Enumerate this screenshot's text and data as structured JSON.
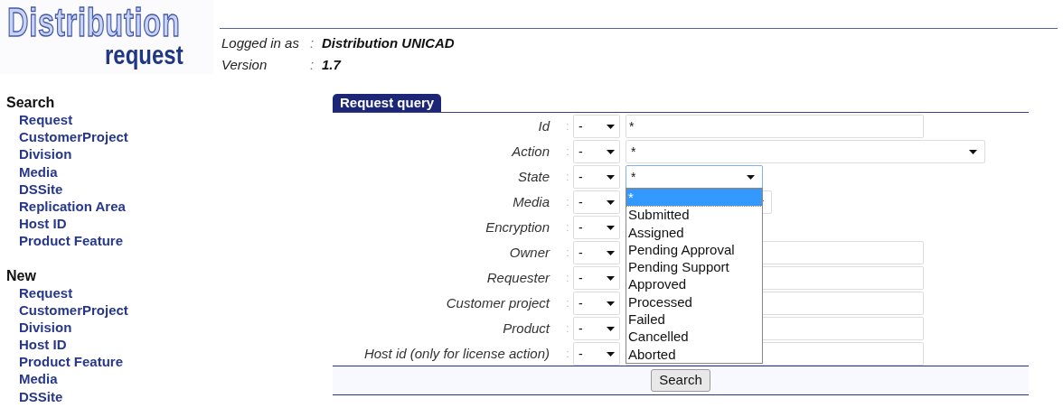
{
  "logo": {
    "title": "Distribution",
    "subtitle": "request"
  },
  "header": {
    "rows": [
      {
        "label": "Logged in as",
        "separator": ":",
        "value": "Distribution UNICAD"
      },
      {
        "label": "Version",
        "separator": ":",
        "value": "1.7"
      }
    ]
  },
  "sidebar": {
    "sections": [
      {
        "heading": "Search",
        "items": [
          "Request",
          "CustomerProject",
          "Division",
          "Media",
          "DSSite",
          "Replication Area",
          "Host ID",
          "Product Feature"
        ]
      },
      {
        "heading": "New",
        "items": [
          "Request",
          "CustomerProject",
          "Division",
          "Host ID",
          "Product Feature",
          "Media",
          "DSSite"
        ]
      }
    ]
  },
  "query": {
    "tab": "Request query",
    "fields": [
      {
        "label": "Id",
        "separator": ":",
        "operator": "-",
        "kind": "text",
        "value": "*"
      },
      {
        "label": "Action",
        "separator": ":",
        "operator": "-",
        "kind": "select",
        "value": "*"
      },
      {
        "label": "State",
        "separator": ":",
        "operator": "-",
        "kind": "select",
        "value": "*",
        "expanded": true
      },
      {
        "label": "Media",
        "separator": ":",
        "operator": "-",
        "kind": "select"
      },
      {
        "label": "Encryption",
        "separator": ":",
        "operator": "-",
        "kind": "hidden"
      },
      {
        "label": "Owner",
        "separator": ":",
        "operator": "-",
        "kind": "text"
      },
      {
        "label": "Requester",
        "separator": ":",
        "operator": "-",
        "kind": "text"
      },
      {
        "label": "Customer project",
        "separator": ":",
        "operator": "-",
        "kind": "text"
      },
      {
        "label": "Product",
        "separator": ":",
        "operator": "-",
        "kind": "text"
      },
      {
        "label": "Host id (only for license action)",
        "separator": ":",
        "operator": "-",
        "kind": "text"
      }
    ],
    "options": [
      {
        "label": "*",
        "selected": true
      },
      {
        "label": "Submitted",
        "selected": false
      },
      {
        "label": "Assigned",
        "selected": false
      },
      {
        "label": "Pending Approval",
        "selected": false
      },
      {
        "label": "Pending Support",
        "selected": false
      },
      {
        "label": "Approved",
        "selected": false
      },
      {
        "label": "Processed",
        "selected": false
      },
      {
        "label": "Failed",
        "selected": false
      },
      {
        "label": "Cancelled",
        "selected": false
      },
      {
        "label": "Aborted",
        "selected": false
      }
    ],
    "button": "Search"
  }
}
